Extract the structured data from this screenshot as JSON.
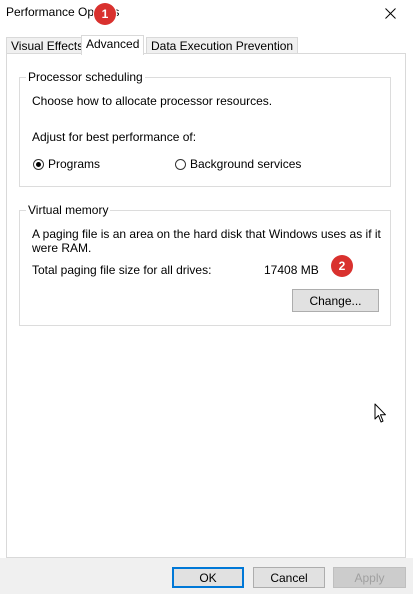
{
  "window": {
    "title": "Performance Options",
    "close_glyph": "close-icon"
  },
  "tabs": [
    {
      "label": "Visual Effects",
      "active": false
    },
    {
      "label": "Advanced",
      "active": true
    },
    {
      "label": "Data Execution Prevention",
      "active": false
    }
  ],
  "processor_scheduling": {
    "legend": "Processor scheduling",
    "description": "Choose how to allocate processor resources.",
    "adjust_label": "Adjust for best performance of:",
    "options": [
      {
        "label": "Programs",
        "checked": true
      },
      {
        "label": "Background services",
        "checked": false
      }
    ]
  },
  "virtual_memory": {
    "legend": "Virtual memory",
    "description": "A paging file is an area on the hard disk that Windows uses as if it were RAM.",
    "total_label": "Total paging file size for all drives:",
    "total_value": "17408 MB",
    "change_button": "Change..."
  },
  "footer": {
    "ok": "OK",
    "cancel": "Cancel",
    "apply": "Apply"
  },
  "annotations": {
    "badge_1": "1",
    "badge_2": "2",
    "badge_color": "#d9312e"
  }
}
